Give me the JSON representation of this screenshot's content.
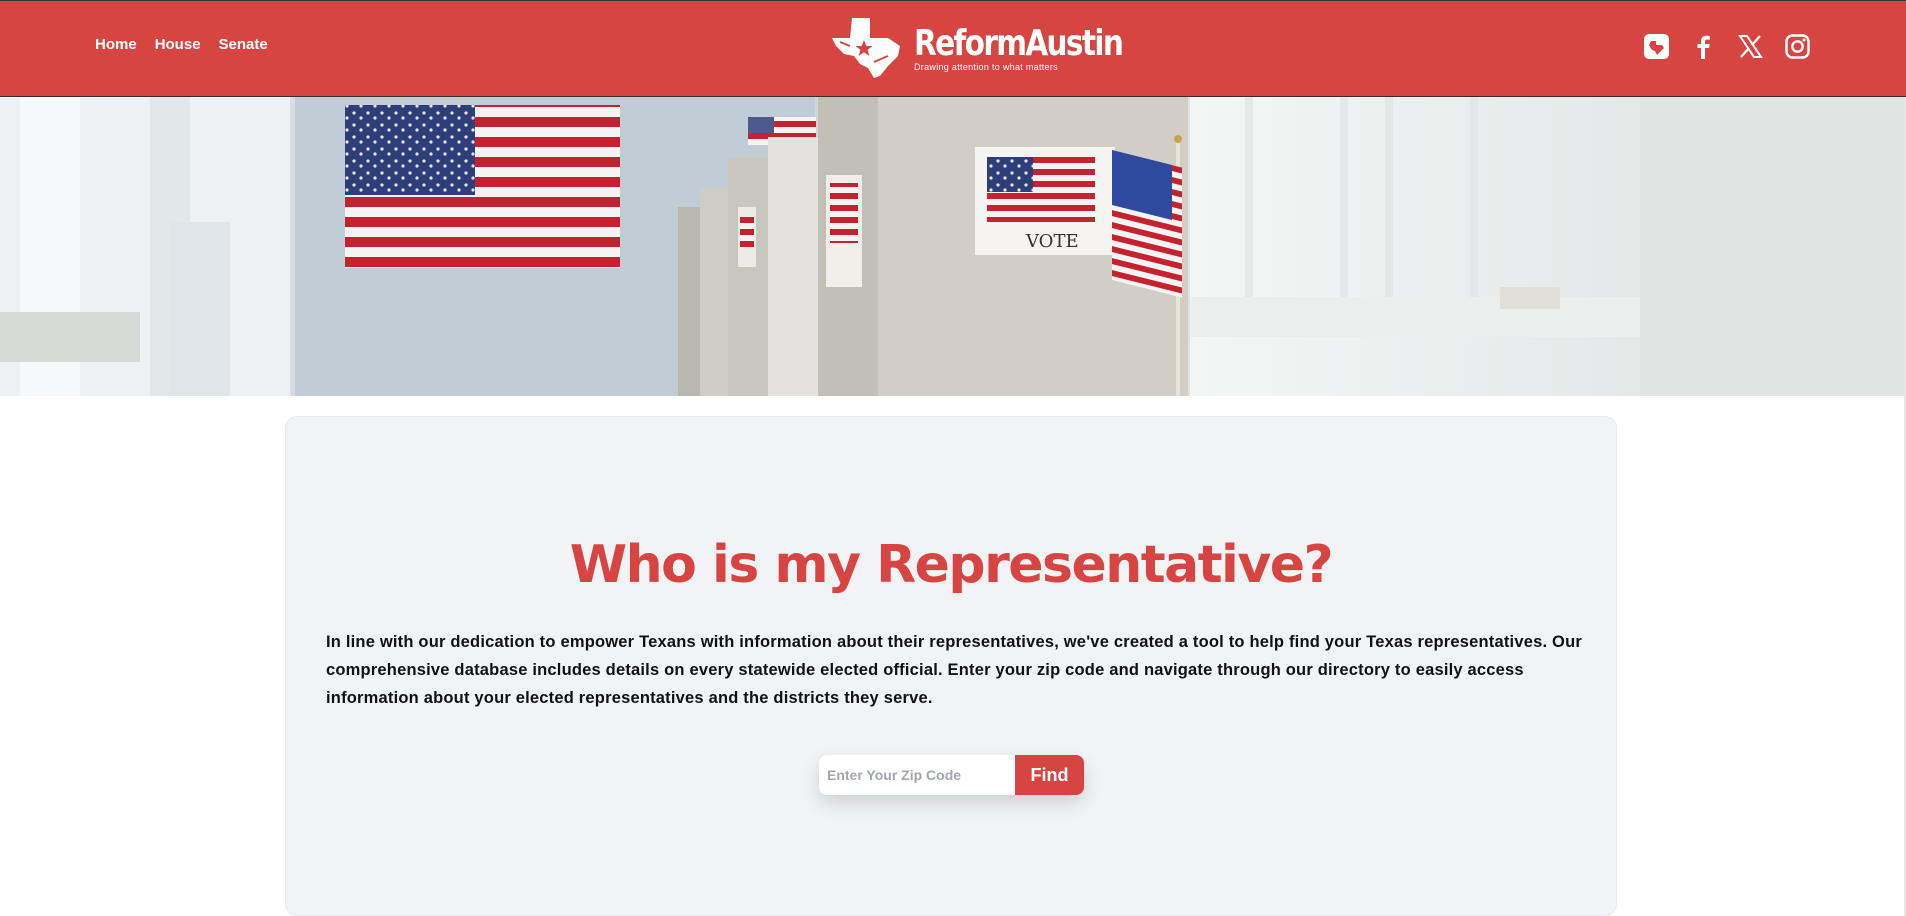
{
  "header": {
    "nav": [
      {
        "label": "Home"
      },
      {
        "label": "House"
      },
      {
        "label": "Senate"
      }
    ],
    "logo": {
      "name": "ReformAustin",
      "tagline": "Drawing attention to what matters",
      "icon": "texas-star-logo-icon"
    },
    "social": [
      {
        "icon": "texas-app-icon"
      },
      {
        "icon": "facebook-icon"
      },
      {
        "icon": "x-twitter-icon"
      },
      {
        "icon": "instagram-icon"
      }
    ]
  },
  "hero": {
    "image": "polling-booths-with-american-flags",
    "sign_text": "VOTE"
  },
  "main": {
    "heading": "Who is my Representative?",
    "intro": "In line with our dedication to empower Texans with information about their representatives, we've created a tool to help find your Texas representatives. Our comprehensive database includes details on every statewide elected official. Enter your zip code and navigate through our directory to easily access information about your elected representatives and the districts they serve.",
    "search": {
      "placeholder": "Enter Your Zip Code",
      "value": "",
      "button_label": "Find"
    }
  },
  "colors": {
    "brand_red": "#d64541",
    "card_bg": "#f2f3f5",
    "text": "#111111"
  }
}
